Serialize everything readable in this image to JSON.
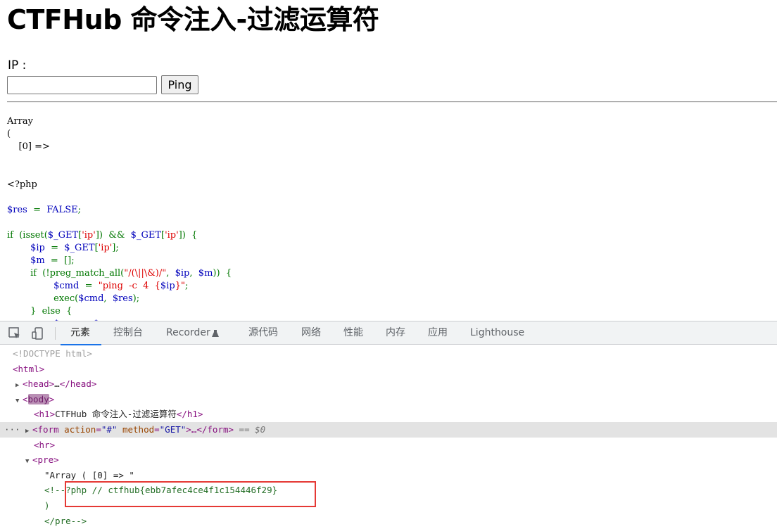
{
  "page": {
    "title": "CTFHub 命令注入-过滤运算符",
    "ip_label": "IP :",
    "ip_input_value": "",
    "ping_button": "Ping",
    "output_lines": [
      "Array",
      "(",
      "    [0] =>"
    ]
  },
  "code": {
    "lines": [
      [
        [
          "d",
          "<?php"
        ]
      ],
      [],
      [
        [
          "v",
          "$res"
        ],
        [
          "k",
          "  =  "
        ],
        [
          "v",
          "FALSE"
        ],
        [
          "k",
          ";"
        ]
      ],
      [],
      [
        [
          "k",
          "if  (isset("
        ],
        [
          "v",
          "$_GET"
        ],
        [
          "k",
          "["
        ],
        [
          "s",
          "'ip'"
        ],
        [
          "k",
          "])  &&  "
        ],
        [
          "v",
          "$_GET"
        ],
        [
          "k",
          "["
        ],
        [
          "s",
          "'ip'"
        ],
        [
          "k",
          "])  {"
        ]
      ],
      [
        [
          "d",
          "        "
        ],
        [
          "v",
          "$ip"
        ],
        [
          "k",
          "  =  "
        ],
        [
          "v",
          "$_GET"
        ],
        [
          "k",
          "["
        ],
        [
          "s",
          "'ip'"
        ],
        [
          "k",
          "];"
        ]
      ],
      [
        [
          "d",
          "        "
        ],
        [
          "v",
          "$m"
        ],
        [
          "k",
          "  =  [];"
        ]
      ],
      [
        [
          "d",
          "        "
        ],
        [
          "k",
          "if  (!preg_match_all("
        ],
        [
          "s",
          "\"/(\\||\\&)/\""
        ],
        [
          "k",
          ",  "
        ],
        [
          "v",
          "$ip"
        ],
        [
          "k",
          ",  "
        ],
        [
          "v",
          "$m"
        ],
        [
          "k",
          "))  {"
        ]
      ],
      [
        [
          "d",
          "                "
        ],
        [
          "v",
          "$cmd"
        ],
        [
          "k",
          "  =  "
        ],
        [
          "s",
          "\"ping  -c  4  {"
        ],
        [
          "v",
          "$ip"
        ],
        [
          "s",
          "}\""
        ],
        [
          "k",
          ";"
        ]
      ],
      [
        [
          "d",
          "                "
        ],
        [
          "k",
          "exec("
        ],
        [
          "v",
          "$cmd"
        ],
        [
          "k",
          ",  "
        ],
        [
          "v",
          "$res"
        ],
        [
          "k",
          ");"
        ]
      ],
      [
        [
          "d",
          "        "
        ],
        [
          "k",
          "}  else  {"
        ]
      ],
      [
        [
          "d",
          "                "
        ],
        [
          "v",
          "$res"
        ],
        [
          "k",
          "  =  "
        ],
        [
          "v",
          "$m"
        ],
        [
          "k",
          ";"
        ]
      ]
    ]
  },
  "devtools": {
    "tabs": [
      "元素",
      "控制台",
      "Recorder",
      "源代码",
      "网络",
      "性能",
      "内存",
      "应用",
      "Lighthouse"
    ],
    "active_tab": "元素",
    "dom": {
      "doctype": "<!DOCTYPE html>",
      "html_open": "<html>",
      "head": [
        "<head>",
        "…",
        "</head>"
      ],
      "body_open": [
        "<",
        "body",
        ">"
      ],
      "h1": [
        "<h1>",
        "CTFHub 命令注入-过滤运算符",
        "</h1>"
      ],
      "form": {
        "open_start": "<form",
        "attr1_name": " action",
        "attr1_value": "\"#\"",
        "attr2_name": " method",
        "attr2_value": "\"GET\"",
        "open_end": ">…</form>",
        "selected_marker": " == $0"
      },
      "hr": "<hr>",
      "pre_open": "<pre>",
      "text_line": "\"Array ( [0] => \"",
      "comment_start": "<!--",
      "comment_content": "?php // ctfhub{ebb7afec4ce4f1c154446f29}",
      "close_paren": ")",
      "pre_close": "</pre-->",
      "ellipsis": "···"
    }
  },
  "highlight_color": "#e53935"
}
